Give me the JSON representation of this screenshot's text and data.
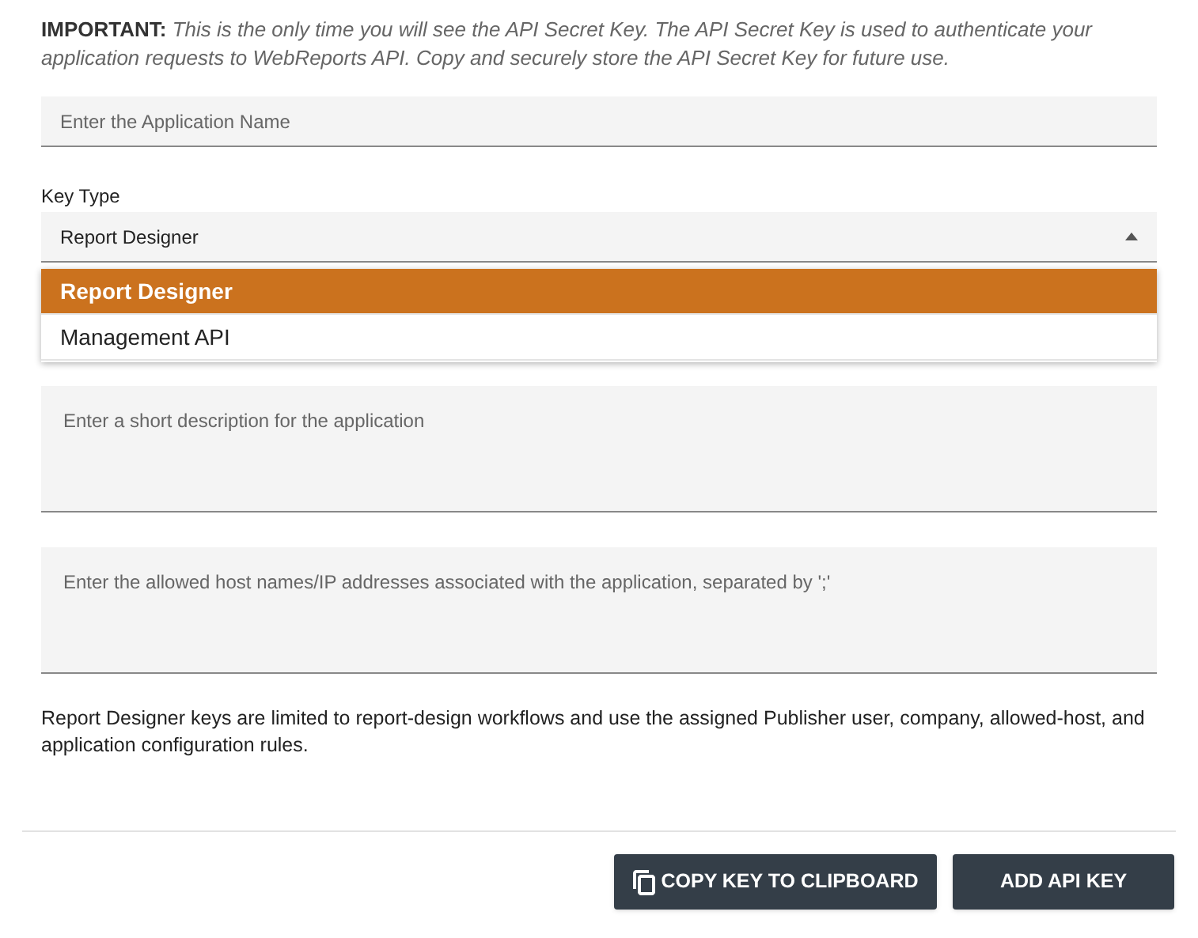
{
  "notice": "**IMPORTANT:** *This is the only time you will see the API Secret Key. The API Secret Key is used to authenticate your application requests to WebReports API. Copy and securely store the API Secret Key for future use.*",
  "app_name": {
    "placeholder": "Enter the Application Name"
  },
  "key_type": {
    "label": "Key Type",
    "value": "Report Designer",
    "expanded": true,
    "options": [
      {
        "label": "Report Designer",
        "selected": true
      },
      {
        "label": "Management API",
        "selected": false
      }
    ]
  },
  "description": {
    "placeholder": "Enter a short description for the application"
  },
  "hosts": {
    "placeholder": "Enter the allowed host names/IP addresses associated with the application, separated by ';'"
  },
  "info": "Report Designer keys are limited to report-design workflows and use the assigned Publisher user, company, allowed-host, and application configuration rules.",
  "buttons": [
    {
      "kind": "copy",
      "label": "COPY KEY TO CLIPBOARD"
    },
    {
      "kind": "add",
      "label": "ADD API KEY"
    }
  ]
}
